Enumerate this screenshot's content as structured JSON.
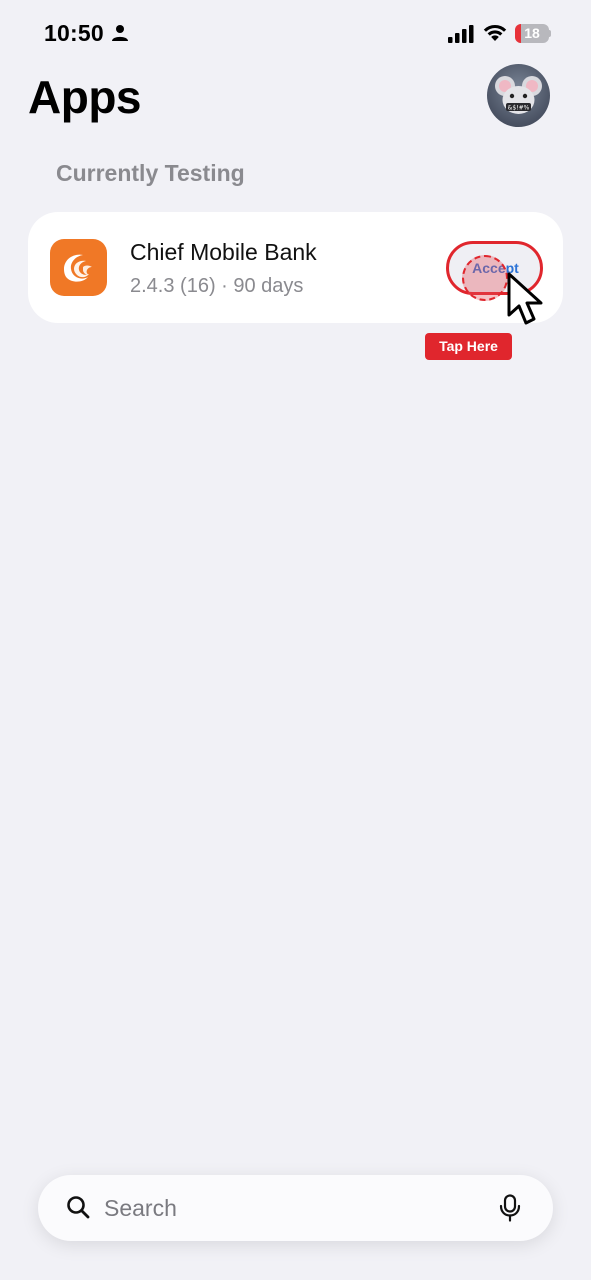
{
  "status_bar": {
    "time": "10:50",
    "battery_percent": "18",
    "battery_level": 0.18,
    "icons": [
      "person-icon",
      "signal-icon",
      "wifi-icon",
      "battery-icon"
    ]
  },
  "header": {
    "title": "Apps",
    "avatar_icon": "avatar"
  },
  "section": {
    "title": "Currently Testing"
  },
  "apps": [
    {
      "name": "Chief Mobile Bank",
      "meta": "2.4.3 (16) · 90 days",
      "action_label": "Accept",
      "icon": "chief-mobile-bank-icon"
    }
  ],
  "annotation": {
    "tap_label": "Tap Here"
  },
  "search": {
    "placeholder": "Search",
    "value": ""
  },
  "colors": {
    "background": "#f1f1f6",
    "card": "#ffffff",
    "accent_blue": "#2c73d6",
    "annotation_red": "#e0262d",
    "app_icon_orange": "#f07826",
    "secondary_text": "#8a8a8f"
  }
}
